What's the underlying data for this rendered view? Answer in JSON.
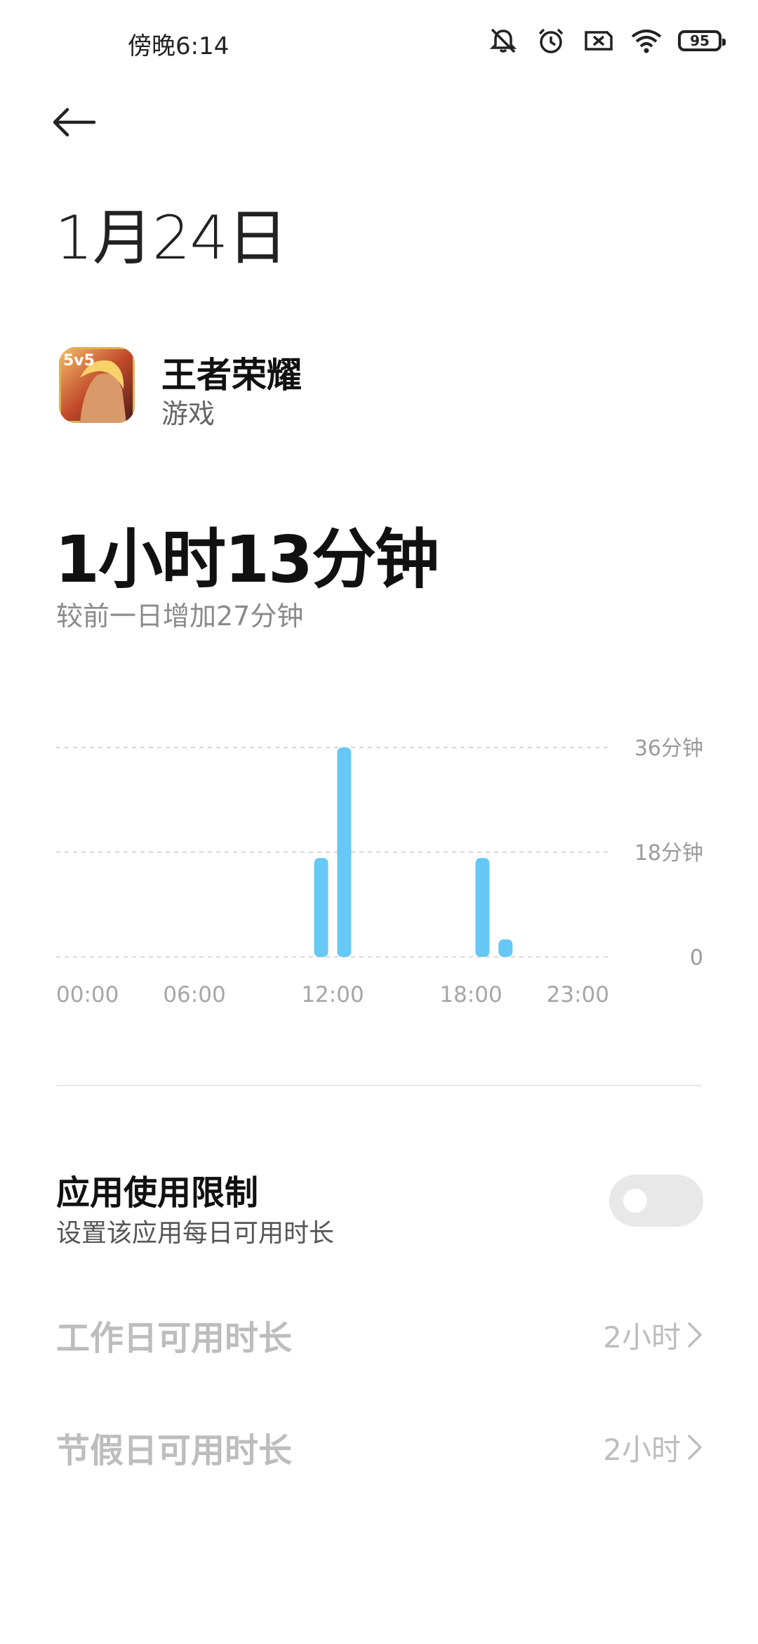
{
  "status_bar": {
    "time": "傍晚6:14",
    "battery": "95",
    "icons": [
      "notifications-off-icon",
      "alarm-icon",
      "sim-off-icon",
      "wifi-icon",
      "battery-icon"
    ]
  },
  "header": {
    "back_icon": "back-arrow-icon",
    "title": "1月24日"
  },
  "app": {
    "name": "王者荣耀",
    "category": "游戏",
    "icon": "app-icon-honor-of-kings"
  },
  "usage": {
    "total": "1小时13分钟",
    "compare": "较前一日增加27分钟"
  },
  "chart_data": {
    "type": "bar",
    "x_tick_labels": [
      "00:00",
      "06:00",
      "12:00",
      "18:00",
      "23:00"
    ],
    "y_tick_labels": [
      "36分钟",
      "18分钟",
      "0"
    ],
    "ylim": [
      0,
      36
    ],
    "hours": [
      11,
      12,
      18,
      19
    ],
    "values": [
      17,
      36,
      17,
      3
    ],
    "bar_color": "#66c8f5",
    "grid": true
  },
  "limit": {
    "title": "应用使用限制",
    "description": "设置该应用每日可用时长",
    "enabled": false
  },
  "rows": [
    {
      "label": "工作日可用时长",
      "value": "2小时"
    },
    {
      "label": "节假日可用时长",
      "value": "2小时"
    }
  ]
}
